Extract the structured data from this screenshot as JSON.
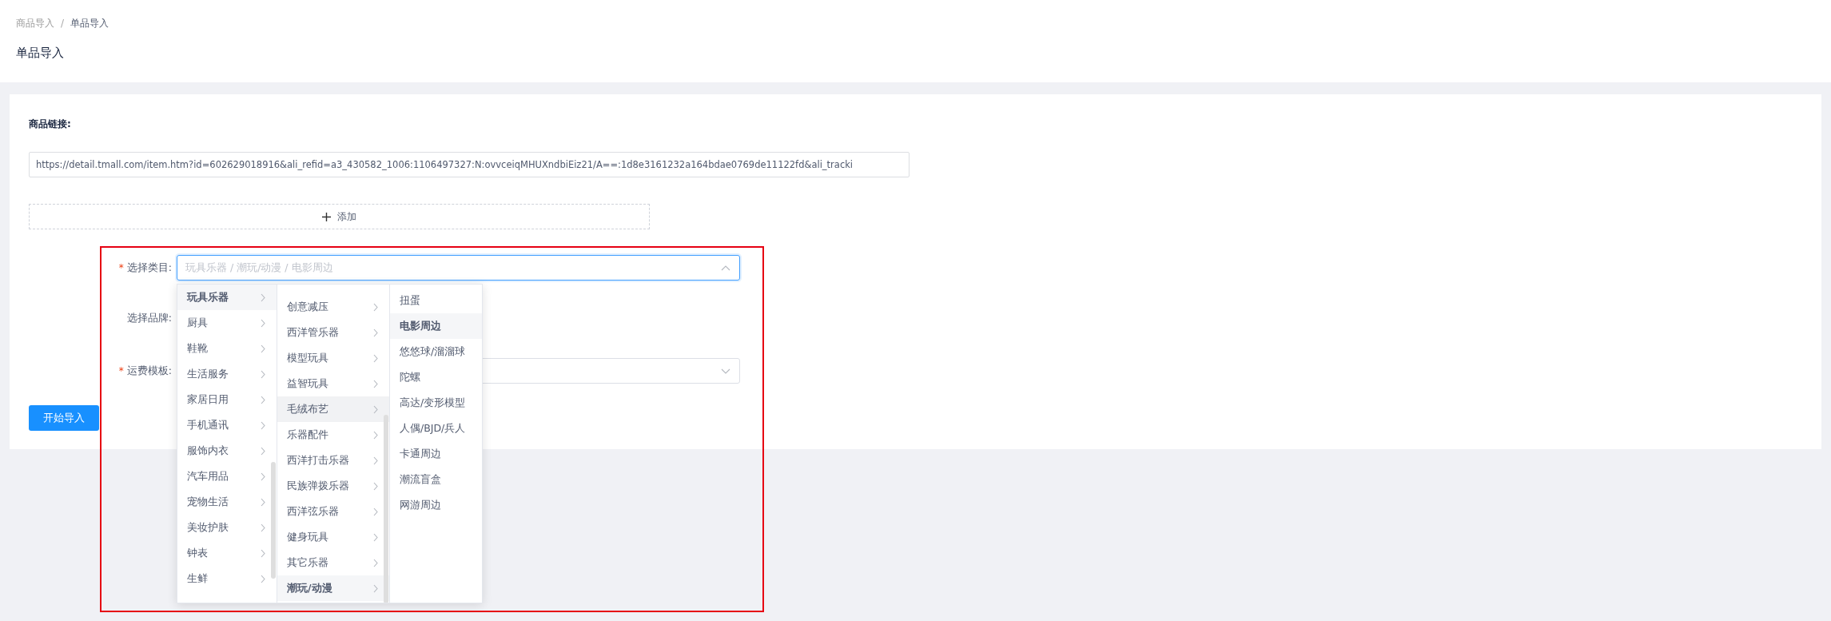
{
  "breadcrumb": [
    {
      "label": "商品导入",
      "current": false
    },
    {
      "label": "单品导入",
      "current": true
    }
  ],
  "breadcrumb_separator": "/",
  "page_title": "单品导入",
  "link_section": {
    "label": "商品链接:",
    "value": "https://detail.tmall.com/item.htm?id=602629018916&ali_refid=a3_430582_1006:1106497327:N:ovvceiqMHUXndbiEiz21/A==:1d8e3161232a164bdae0769de11122fd&ali_tracki"
  },
  "add_button": {
    "label": "添加"
  },
  "form": {
    "fields": [
      {
        "kind": "cascader",
        "label": "选择类目:",
        "required_mark": "*",
        "placeholder": "玩具乐器 / 潮玩/动漫 / 电影周边",
        "expanded": true
      },
      {
        "kind": "empty",
        "label": "选择品牌:"
      },
      {
        "kind": "select",
        "label": "运费模板:",
        "required_mark": "*",
        "expanded": false
      }
    ]
  },
  "cascader_menus": [
    {
      "leaf": false,
      "items": [
        {
          "label": "玩具乐器",
          "selected": true,
          "hovered": false
        },
        {
          "label": "厨具",
          "selected": false,
          "hovered": false
        },
        {
          "label": "鞋靴",
          "selected": false,
          "hovered": false
        },
        {
          "label": "生活服务",
          "selected": false,
          "hovered": false
        },
        {
          "label": "家居日用",
          "selected": false,
          "hovered": false
        },
        {
          "label": "手机通讯",
          "selected": false,
          "hovered": false
        },
        {
          "label": "服饰内衣",
          "selected": false,
          "hovered": false
        },
        {
          "label": "汽车用品",
          "selected": false,
          "hovered": false
        },
        {
          "label": "宠物生活",
          "selected": false,
          "hovered": false
        },
        {
          "label": "美妆护肤",
          "selected": false,
          "hovered": false
        },
        {
          "label": "钟表",
          "selected": false,
          "hovered": false
        },
        {
          "label": "生鲜",
          "selected": false,
          "hovered": false
        }
      ]
    },
    {
      "leaf": false,
      "items": [
        {
          "label": "创意减压",
          "selected": false,
          "hovered": false
        },
        {
          "label": "西洋管乐器",
          "selected": false,
          "hovered": false
        },
        {
          "label": "模型玩具",
          "selected": false,
          "hovered": false
        },
        {
          "label": "益智玩具",
          "selected": false,
          "hovered": false
        },
        {
          "label": "毛绒布艺",
          "selected": false,
          "hovered": true
        },
        {
          "label": "乐器配件",
          "selected": false,
          "hovered": false
        },
        {
          "label": "西洋打击乐器",
          "selected": false,
          "hovered": false
        },
        {
          "label": "民族弹拨乐器",
          "selected": false,
          "hovered": false
        },
        {
          "label": "西洋弦乐器",
          "selected": false,
          "hovered": false
        },
        {
          "label": "健身玩具",
          "selected": false,
          "hovered": false
        },
        {
          "label": "其它乐器",
          "selected": false,
          "hovered": false
        },
        {
          "label": "潮玩/动漫",
          "selected": true,
          "hovered": false
        }
      ]
    },
    {
      "leaf": true,
      "items": [
        {
          "label": "扭蛋",
          "selected": false,
          "hovered": false
        },
        {
          "label": "电影周边",
          "selected": true,
          "hovered": false
        },
        {
          "label": "悠悠球/溜溜球",
          "selected": false,
          "hovered": false
        },
        {
          "label": "陀螺",
          "selected": false,
          "hovered": false
        },
        {
          "label": "高达/变形模型",
          "selected": false,
          "hovered": false
        },
        {
          "label": "人偶/BJD/兵人",
          "selected": false,
          "hovered": false
        },
        {
          "label": "卡通周边",
          "selected": false,
          "hovered": false
        },
        {
          "label": "潮流盲盒",
          "selected": false,
          "hovered": false
        },
        {
          "label": "网游周边",
          "selected": false,
          "hovered": false
        }
      ]
    }
  ],
  "start_button": {
    "label": "开始导入"
  }
}
